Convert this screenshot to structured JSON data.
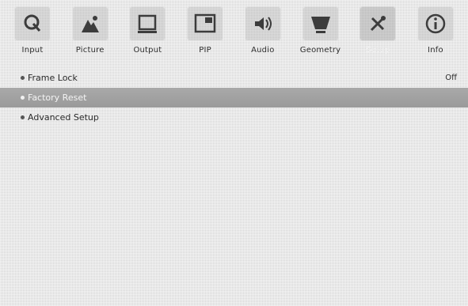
{
  "tabs": [
    {
      "label": "Input",
      "icon": "input-icon"
    },
    {
      "label": "Picture",
      "icon": "picture-icon"
    },
    {
      "label": "Output",
      "icon": "output-icon"
    },
    {
      "label": "PIP",
      "icon": "pip-icon"
    },
    {
      "label": "Audio",
      "icon": "audio-icon"
    },
    {
      "label": "Geometry",
      "icon": "geometry-icon"
    },
    {
      "label": "Setup",
      "icon": "setup-icon",
      "active": true
    },
    {
      "label": "Info",
      "icon": "info-icon"
    }
  ],
  "menu": {
    "items": [
      {
        "label": "Frame Lock",
        "value": "Off"
      },
      {
        "label": "Factory Reset",
        "value": "",
        "selected": true
      },
      {
        "label": "Advanced Setup",
        "value": ""
      }
    ]
  },
  "colors": {
    "background": "#d4d4d4",
    "selected_row": "#a3a3a3",
    "text": "#2a2a2a",
    "selected_text": "#f4f4f4"
  }
}
